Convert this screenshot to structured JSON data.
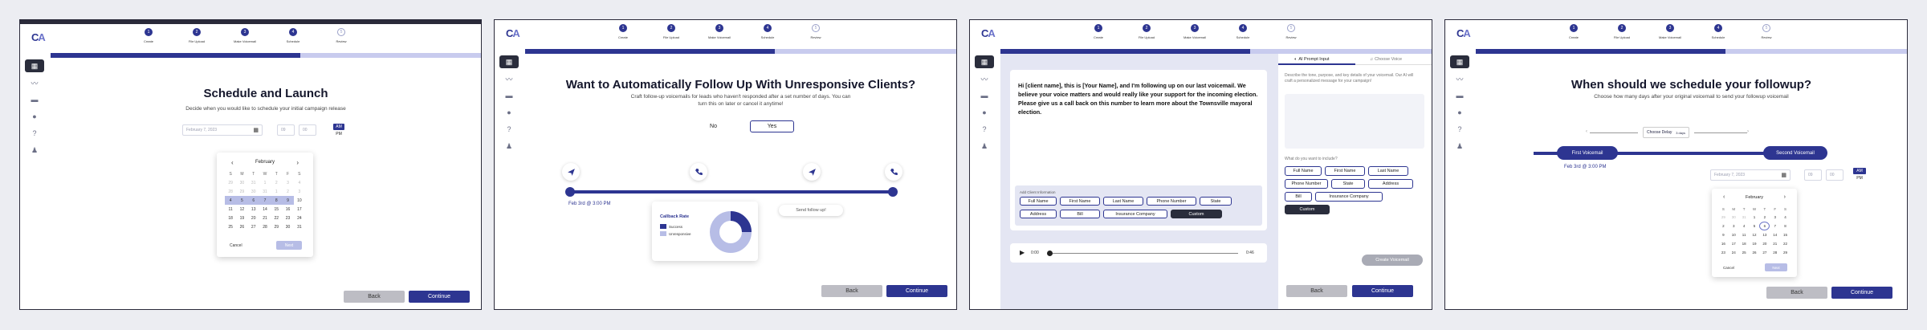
{
  "brand": {
    "logo_c": "C",
    "logo_a": "A"
  },
  "steps": [
    {
      "num": "1",
      "label": "Create",
      "done": true
    },
    {
      "num": "2",
      "label": "File Upload",
      "done": true
    },
    {
      "num": "3",
      "label": "Make Voicemail",
      "done": true
    },
    {
      "num": "4",
      "label": "Schedule",
      "done": true
    },
    {
      "num": "5",
      "label": "Review",
      "done": false
    }
  ],
  "sidebar_icons": [
    "grid-icon",
    "trend-icon",
    "card-icon",
    "mic-icon",
    "help-icon",
    "user-icon"
  ],
  "common": {
    "back": "Back",
    "continue": "Continue"
  },
  "panel1": {
    "progress": 0.58,
    "title": "Schedule and Launch",
    "subtitle": "Decide when you would like to schedule your initial campaign release",
    "date_placeholder": "February 7, 2023",
    "hour": "09",
    "minute": "00",
    "am": "AM",
    "pm": "PM",
    "calendar": {
      "prev": "‹",
      "next": "›",
      "month": "February",
      "days_header": [
        "S",
        "M",
        "T",
        "W",
        "T",
        "F",
        "S"
      ],
      "rows": [
        [
          "29",
          "30",
          "31",
          "1",
          "2",
          "3",
          "4"
        ],
        [
          "28",
          "29",
          "30",
          "31",
          "1",
          "2",
          "3"
        ],
        [
          "4",
          "5",
          "6",
          "7",
          "8",
          "9",
          "10"
        ],
        [
          "11",
          "12",
          "13",
          "14",
          "15",
          "16",
          "17"
        ],
        [
          "18",
          "19",
          "20",
          "21",
          "22",
          "23",
          "24"
        ],
        [
          "25",
          "26",
          "27",
          "28",
          "29",
          "30",
          "31"
        ]
      ],
      "cancel": "Cancel",
      "next_btn": "Next"
    }
  },
  "panel2": {
    "progress": 0.58,
    "title": "Want to Automatically Follow Up With Unresponsive Clients?",
    "subtitle_1": "Craft follow-up voicemails for leads who haven't responded after a set number of days. You can",
    "subtitle_2": "turn this on later or cancel it anytime!",
    "no": "No",
    "yes": "Yes",
    "date": "Feb 3rd @ 3:00 PM",
    "send_follow_up": "Send follow up!",
    "callback_title": "Callback Rate",
    "legend": [
      {
        "label": "Success",
        "color": "#2d3591"
      },
      {
        "label": "Unresponsive",
        "color": "#b7bde6"
      }
    ],
    "callback_success_share": 0.25
  },
  "panel3": {
    "progress": 0.58,
    "message": "Hi [client name], this is [Your Name], and I'm following up on our last voicemail. We believe your voice matters and would really like your support for the incoming election. Please give us a call back on this number to learn more about the Townsville mayoral election.",
    "add_client_info": "Add Client Information",
    "chips": [
      "Full Name",
      "First Name",
      "Last Name",
      "Phone Number",
      "State",
      "Address",
      "Bill",
      "Insurance Company",
      "Custom"
    ],
    "audio_start": "0:00",
    "audio_end": "0:46",
    "tab_ai": "AI Prompt Input",
    "tab_voice": "Choose Voice",
    "describe": "Describe the tone, purpose, and key details of your voicemail. Our AI will craft a personalized message for your campaign!",
    "include_label": "What do you want to include?",
    "include_chips": [
      "Full Name",
      "First Name",
      "Last Name",
      "Phone Number",
      "State",
      "Address",
      "Bill",
      "Insurance Company",
      "Custom"
    ],
    "create_voicemail": "Create Voicemail"
  },
  "panel4": {
    "progress": 0.58,
    "title": "When should we schedule your followup?",
    "subtitle": "Choose how many days after your original voicemail to send your followup voicemail",
    "choose_delay": "Choose Delay",
    "delay_value": "3 days",
    "first_voicemail": "First Voicemail",
    "second_voicemail": "Second Voicemail",
    "date": "Feb 3rd @ 3:00 PM",
    "date_placeholder": "February 7, 2023",
    "hour": "09",
    "minute": "00",
    "am": "AM",
    "pm": "PM",
    "calendar": {
      "prev": "‹",
      "next": "›",
      "month": "February",
      "days_header": [
        "S",
        "M",
        "T",
        "W",
        "T",
        "F",
        "S"
      ],
      "rows": [
        [
          "29",
          "30",
          "31",
          "1",
          "2",
          "3",
          "4"
        ],
        [
          "2",
          "3",
          "4",
          "5",
          "6",
          "7",
          "8"
        ],
        [
          "9",
          "10",
          "11",
          "12",
          "13",
          "14",
          "15"
        ],
        [
          "16",
          "17",
          "18",
          "19",
          "20",
          "21",
          "22"
        ],
        [
          "23",
          "24",
          "25",
          "26",
          "27",
          "28",
          "29"
        ]
      ],
      "cancel": "Cancel",
      "next_btn": "Next"
    }
  }
}
